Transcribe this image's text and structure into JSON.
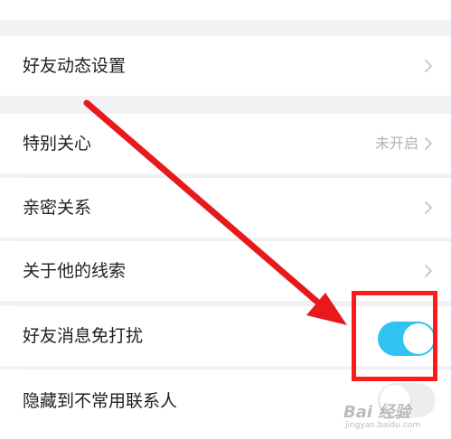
{
  "settings": {
    "items": [
      {
        "label": "好友动态设置",
        "value": "",
        "control": "chevron"
      },
      {
        "label": "特别关心",
        "value": "未开启",
        "control": "chevron"
      },
      {
        "label": "亲密关系",
        "value": "",
        "control": "chevron"
      },
      {
        "label": "关于他的线索",
        "value": "",
        "control": "chevron"
      },
      {
        "label": "好友消息免打扰",
        "value": "",
        "control": "toggle",
        "toggle_on": true
      },
      {
        "label": "隐藏到不常用联系人",
        "value": "",
        "control": "toggle",
        "toggle_on": false
      }
    ]
  },
  "annotation": {
    "arrow_color": "#e8191b",
    "highlight_color": "#ff1a1a"
  },
  "watermark": {
    "logo": "Bai 经验",
    "url": "jingyan.baidu.com"
  },
  "colors": {
    "toggle_on": "#2fc3f2",
    "background": "#f2f2f5"
  }
}
